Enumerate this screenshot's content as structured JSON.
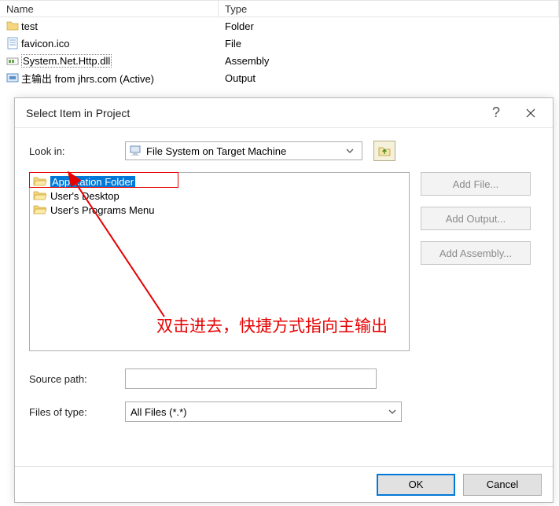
{
  "bg": {
    "headers": {
      "name": "Name",
      "type": "Type"
    },
    "rows": [
      {
        "name": "test",
        "type": "Folder",
        "icon": "folder"
      },
      {
        "name": "favicon.ico",
        "type": "File",
        "icon": "file"
      },
      {
        "name": "System.Net.Http.dll",
        "type": "Assembly",
        "icon": "asm"
      },
      {
        "name": "主输出 from jhrs.com (Active)",
        "type": "Output",
        "icon": "out"
      }
    ]
  },
  "dialog": {
    "title": "Select Item in Project",
    "help": "?",
    "lookin_label": "Look in:",
    "lookin_value": "File System on Target Machine",
    "tree": {
      "items": [
        {
          "label": "Application Folder",
          "selected": true
        },
        {
          "label": "User's Desktop",
          "selected": false
        },
        {
          "label": "User's Programs Menu",
          "selected": false
        }
      ]
    },
    "side": {
      "addfile": "Add File...",
      "addoutput": "Add Output...",
      "addassembly": "Add Assembly..."
    },
    "source_label": "Source path:",
    "source_value": "",
    "files_label": "Files of type:",
    "files_value": "All Files (*.*)",
    "ok": "OK",
    "cancel": "Cancel"
  },
  "annotation": "双击进去，快捷方式指向主输出"
}
